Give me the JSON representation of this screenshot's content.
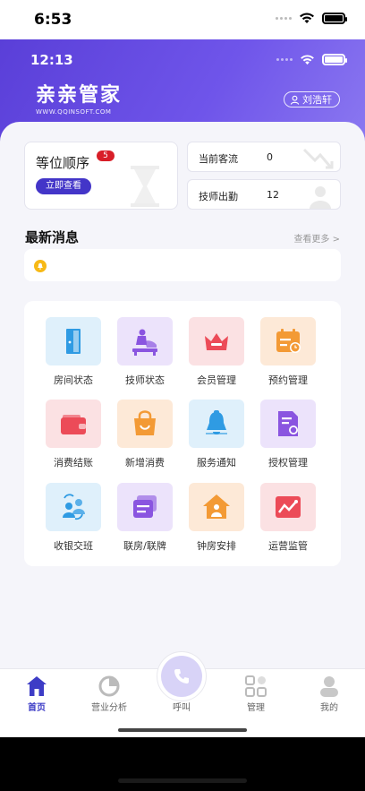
{
  "device_status": {
    "time": "6:53"
  },
  "app_status": {
    "time": "12:13"
  },
  "header": {
    "logo_text": "亲亲管家",
    "logo_subtitle": "WWW.QQINSOFT.COM",
    "user_name": "刘浩轩"
  },
  "queue_card": {
    "title": "等位顺序",
    "badge": "5",
    "button": "立即查看"
  },
  "stats": [
    {
      "label": "当前客流",
      "value": "0"
    },
    {
      "label": "技师出勤",
      "value": "12"
    }
  ],
  "news": {
    "title": "最新消息",
    "more": "查看更多 >"
  },
  "grid": [
    {
      "label": "房间状态",
      "icon": "door-icon",
      "bg": "#dff0fb",
      "color": "#2f9be3"
    },
    {
      "label": "技师状态",
      "icon": "massage-icon",
      "bg": "#ece3fb",
      "color": "#8a55e0"
    },
    {
      "label": "会员管理",
      "icon": "crown-icon",
      "bg": "#fbe1e3",
      "color": "#ec4b58"
    },
    {
      "label": "预约管理",
      "icon": "calendar-icon",
      "bg": "#fde9d7",
      "color": "#f39a35"
    },
    {
      "label": "消费结账",
      "icon": "wallet-icon",
      "bg": "#fbe1e3",
      "color": "#ec4b58"
    },
    {
      "label": "新增消费",
      "icon": "bag-icon",
      "bg": "#fde9d7",
      "color": "#f39a35"
    },
    {
      "label": "服务通知",
      "icon": "bell-icon",
      "bg": "#dff0fb",
      "color": "#2f9be3"
    },
    {
      "label": "授权管理",
      "icon": "certificate-icon",
      "bg": "#ece3fb",
      "color": "#8a55e0"
    },
    {
      "label": "收银交班",
      "icon": "users-swap-icon",
      "bg": "#dff0fb",
      "color": "#2f9be3"
    },
    {
      "label": "联房/联牌",
      "icon": "cards-icon",
      "bg": "#ece3fb",
      "color": "#8a55e0"
    },
    {
      "label": "钟房安排",
      "icon": "house-icon",
      "bg": "#fde9d7",
      "color": "#f39a35"
    },
    {
      "label": "运营监管",
      "icon": "trend-icon",
      "bg": "#fbe1e3",
      "color": "#ec4b58"
    }
  ],
  "tabs": [
    {
      "label": "首页",
      "icon": "home-icon",
      "active": true
    },
    {
      "label": "营业分析",
      "icon": "pie-chart-icon"
    },
    {
      "label": "呼叫",
      "icon": "phone-icon"
    },
    {
      "label": "管理",
      "icon": "grid-icon"
    },
    {
      "label": "我的",
      "icon": "person-icon"
    }
  ],
  "colors": {
    "brand": "#5a3fd8",
    "button": "#4335c8",
    "badge": "#d81e28",
    "bell": "#f7b916"
  }
}
